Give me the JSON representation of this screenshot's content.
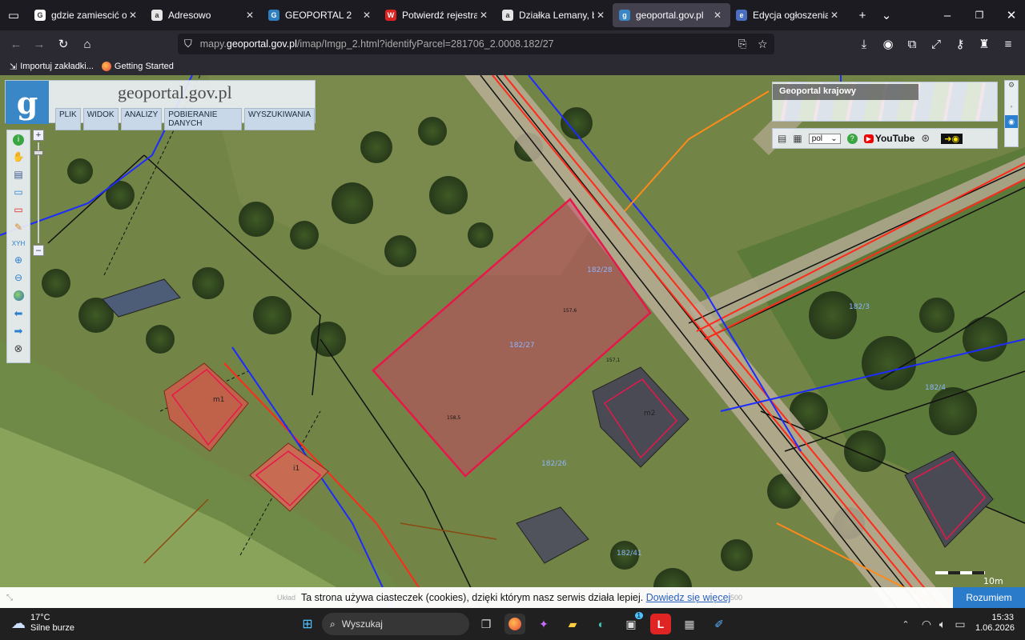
{
  "tabs": [
    {
      "title": "gdzie zamiescić ogłosz",
      "color": "#ffffff",
      "glyph": "G",
      "active": false
    },
    {
      "title": "Adresowo",
      "color": "#e5e5e5",
      "glyph": "a",
      "active": false
    },
    {
      "title": "GEOPORTAL 2",
      "color": "#2d7fc1",
      "glyph": "G",
      "active": false
    },
    {
      "title": "Potwierdź rejestrację w",
      "color": "#d22",
      "glyph": "W",
      "active": false
    },
    {
      "title": "Działka Lemany, bez p",
      "color": "#e5e5e5",
      "glyph": "a",
      "active": false
    },
    {
      "title": "geoportal.gov.pl",
      "color": "#3a87c8",
      "glyph": "g",
      "active": true
    },
    {
      "title": "Edycja ogłoszenia: spr",
      "color": "#4b6fc0",
      "glyph": "e",
      "active": false
    }
  ],
  "url": {
    "prefix": "mapy.",
    "domain": "geoportal.gov.pl",
    "path": "/imap/Imgp_2.html?identifyParcel=281706_2.0008.182/27"
  },
  "bookmarks": [
    {
      "label": "Importuj zakładki..."
    },
    {
      "label": "Getting Started"
    }
  ],
  "geoportal": {
    "logo_text": "geoportal.gov.pl",
    "menu": [
      "PLIK",
      "WIDOK",
      "ANALIZY",
      "POBIERANIE DANYCH",
      "WYSZUKIWANIA"
    ],
    "overview_title": "Geoportal krajowy",
    "language": "pol",
    "youtube": "YouTube",
    "scale_label": "10m",
    "cookie_text": "Ta strona używa ciasteczek (cookies), dzięki którym nasz serwis działa lepiej.",
    "cookie_link": "Dowiedz się więcej",
    "cookie_button": "Rozumiem",
    "coord_left": "Układ",
    "coord_right": "500"
  },
  "map_labels": {
    "parcel_main": "182/27",
    "parcel_a": "182/28",
    "parcel_b": "182/3",
    "parcel_c": "182/4",
    "parcel_d": "182/26",
    "parcel_e": "182/41",
    "building_m1": "m1",
    "building_m2": "m2",
    "building_i1": "i1",
    "elev_1": "157,6",
    "elev_2": "158,5",
    "elev_3": "157,1"
  },
  "taskbar": {
    "weather_temp": "17°C",
    "weather_desc": "Silne burze",
    "search_placeholder": "Wyszukaj",
    "time": "15:33",
    "date": "1.06.2026",
    "badge": "1"
  },
  "colors": {
    "parcel_outline": "#e8174b",
    "parcel_fill": "#d63b6a",
    "utility_red": "#ff2a1a",
    "utility_blue": "#1c2cff",
    "utility_orange": "#ff8a1a",
    "accent": "#3a87c8"
  }
}
